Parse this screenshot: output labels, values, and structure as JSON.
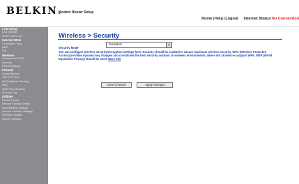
{
  "header": {
    "logo": "BELKIN",
    "logo_mark": ".",
    "subtitle": "Modem Router Setup",
    "nav": {
      "home": "Home",
      "help": "Help",
      "logout": "Logout",
      "sep": "|",
      "status_label": "Internet Status:",
      "status_value": "No Connection"
    },
    "status_color": "#e21d12"
  },
  "sidebar": {
    "items": [
      {
        "label": "LAN Setup",
        "type": "head"
      },
      {
        "label": "LAN Settings",
        "type": "sub"
      },
      {
        "label": "DHCP Client List",
        "type": "sub"
      },
      {
        "label": "Internet WAN",
        "type": "head"
      },
      {
        "label": "Connection Type",
        "type": "sub"
      },
      {
        "label": "DNS",
        "type": "sub"
      },
      {
        "label": "DSL",
        "type": "sub"
      },
      {
        "label": "Wireless",
        "type": "head"
      },
      {
        "label": "Channel and SSID",
        "type": "sub"
      },
      {
        "label": "Security",
        "type": "sub"
      },
      {
        "label": "Wireless Bridge",
        "type": "sub"
      },
      {
        "label": "Firewall",
        "type": "head"
      },
      {
        "label": "Virtual Servers",
        "type": "sub"
      },
      {
        "label": "Client IP Filters",
        "type": "sub"
      },
      {
        "label": "MAC Address Filtering",
        "type": "sub"
      },
      {
        "label": "DMZ",
        "type": "sub"
      },
      {
        "label": "WAN Ping Blocking",
        "type": "sub"
      },
      {
        "label": "Security Log",
        "type": "sub"
      },
      {
        "label": "Utilities",
        "type": "head"
      },
      {
        "label": "Restart Router",
        "type": "sub"
      },
      {
        "label": "Restore Factory Default",
        "type": "sub"
      },
      {
        "label": "Save/Backup Settings",
        "type": "sub"
      },
      {
        "label": "Restore Previous Settings",
        "type": "sub"
      },
      {
        "label": "Firmware Update",
        "type": "sub"
      },
      {
        "label": "System Settings",
        "type": "sub"
      }
    ]
  },
  "main": {
    "title": "Wireless > Security",
    "security_mode_label": "Security Mode",
    "security_mode_value": "Disabled",
    "description": "You can configure wireless security/encryption settings here. Security should be enabled to assure maximum wireless security. WPA (Wireless Protected Access) provides dynamic key changes and constitutes the best security solution. In wireless environments, where not all devices support WPA, WEP (Wired Equivalent Privacy) should be used.",
    "more_info": "More Info",
    "clear_button": "Clear Changes",
    "apply_button": "Apply Changes"
  },
  "colors": {
    "accent": "#1a3fa3",
    "sidebar_bg": "#8a8c92"
  }
}
